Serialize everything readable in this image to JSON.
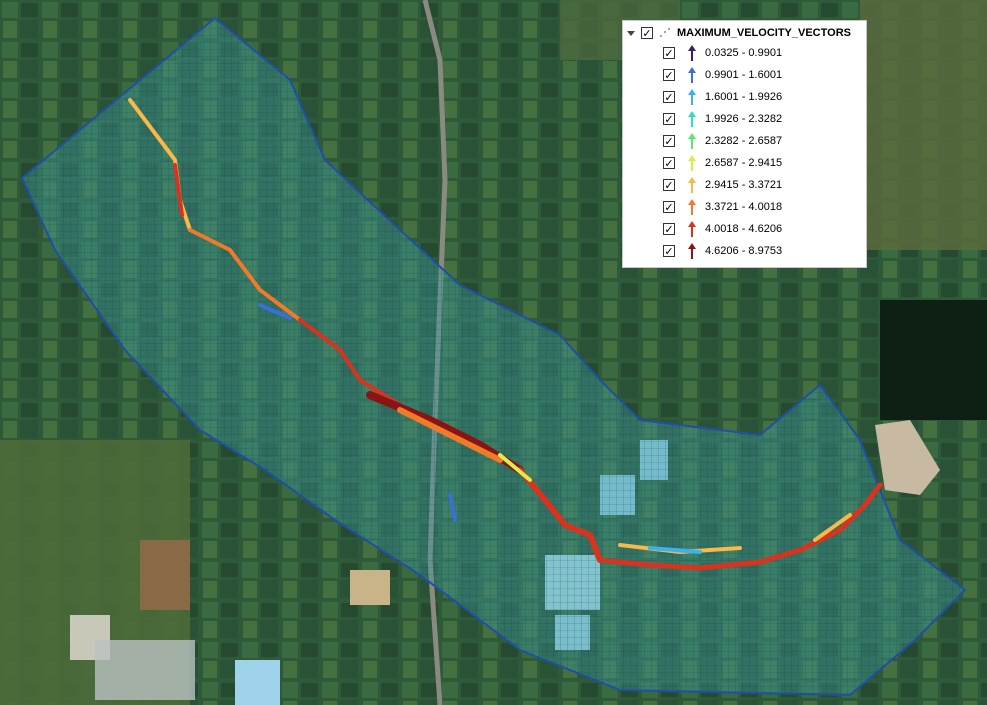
{
  "legend": {
    "layer_name": "MAXIMUM_VELOCITY_VECTORS",
    "checked": true,
    "classes": [
      {
        "label": "0.0325 - 0.9901",
        "color": "#3b1f63"
      },
      {
        "label": "0.9901 - 1.6001",
        "color": "#3a6fd8"
      },
      {
        "label": "1.6001 - 1.9926",
        "color": "#3db0ee"
      },
      {
        "label": "1.9926 - 2.3282",
        "color": "#2fe0c0"
      },
      {
        "label": "2.3282 - 2.6587",
        "color": "#5ee86a"
      },
      {
        "label": "2.6587 - 2.9415",
        "color": "#d8ef4a"
      },
      {
        "label": "2.9415 - 3.3721",
        "color": "#f8b84a"
      },
      {
        "label": "3.3721 - 4.0018",
        "color": "#f07a2a"
      },
      {
        "label": "4.0018 - 4.6206",
        "color": "#d8331e"
      },
      {
        "label": "4.6206 - 8.9753",
        "color": "#8a1414"
      }
    ]
  },
  "map": {
    "domain_color": "#3c9aa0",
    "domain_outline": "#1f4fa8",
    "check_glyph": "✓"
  }
}
